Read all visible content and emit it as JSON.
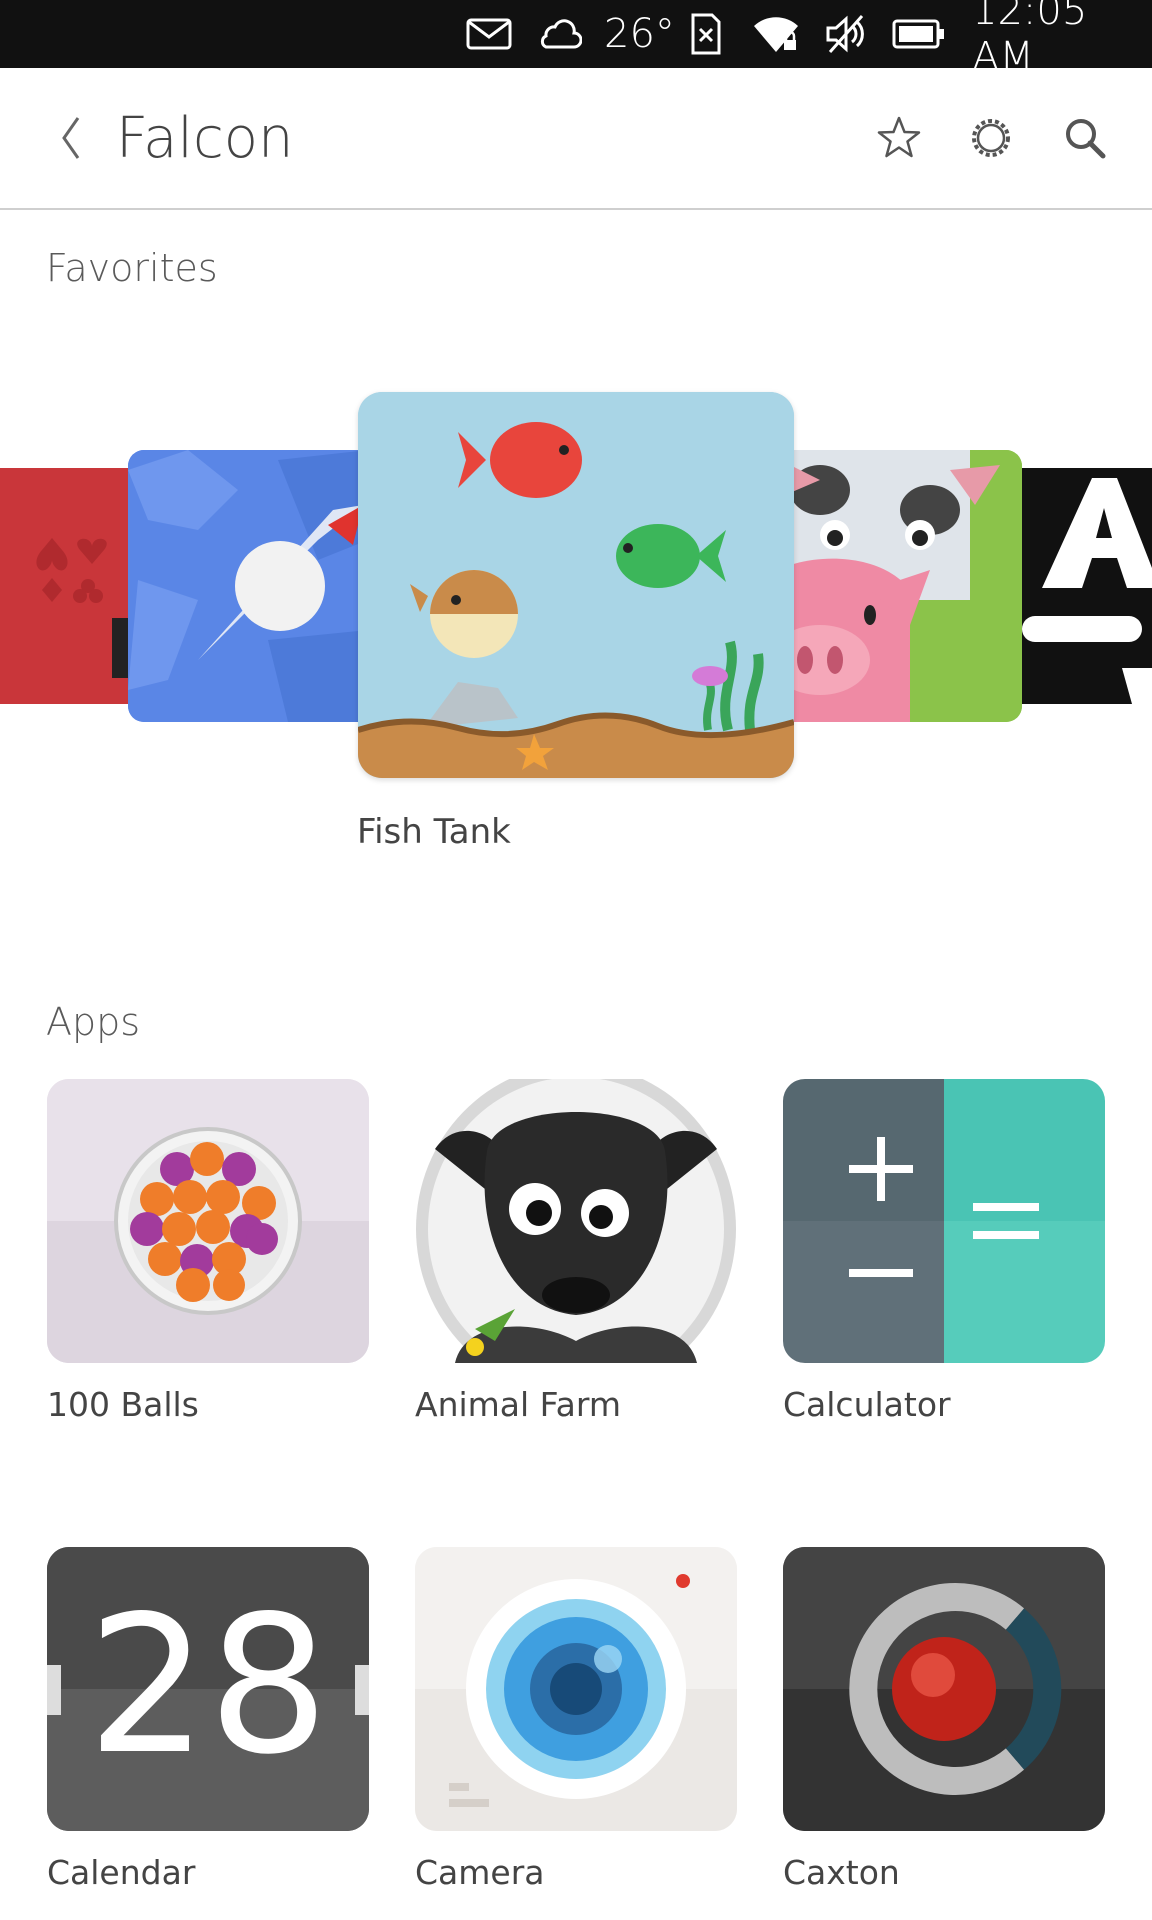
{
  "status_bar": {
    "icons": [
      "mail-icon",
      "cloud-icon",
      "sim-icon",
      "wifi-icon",
      "mute-icon",
      "battery-icon"
    ],
    "temperature": "26°",
    "time": "12:05 AM"
  },
  "header": {
    "title": "Falcon",
    "icons": [
      "back-icon",
      "star-icon",
      "settings-icon",
      "search-icon"
    ]
  },
  "favorites": {
    "heading": "Favorites",
    "caption": "Fish Tank"
  },
  "apps": {
    "heading": "Apps",
    "items": [
      {
        "label": "100 Balls"
      },
      {
        "label": "Animal Farm"
      },
      {
        "label": "Calculator"
      },
      {
        "label": "Calendar",
        "icon_text": "28"
      },
      {
        "label": "Camera"
      },
      {
        "label": "Caxton"
      }
    ]
  },
  "colors": {
    "accent": "#e95420",
    "status_bar_bg": "#111111"
  }
}
